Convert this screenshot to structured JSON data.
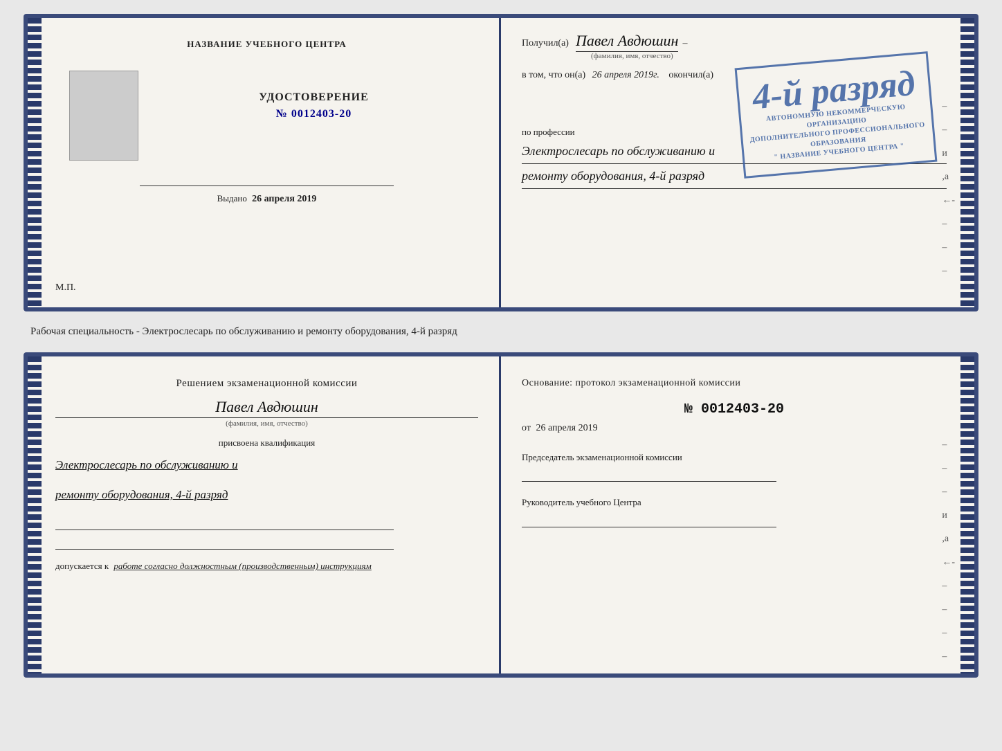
{
  "top_doc": {
    "left_page": {
      "title": "НАЗВАНИЕ УЧЕБНОГО ЦЕНТРА",
      "cert_label": "УДОСТОВЕРЕНИЕ",
      "cert_number": "№ 0012403-20",
      "issued_label": "Выдано",
      "issued_date": "26 апреля 2019",
      "mp_label": "М.П."
    },
    "right_page": {
      "recipient_prefix": "Получил(а)",
      "recipient_name": "Павел Авдюшин",
      "recipient_sub": "(фамилия, имя, отчество)",
      "vtom_prefix": "в том, что он(а)",
      "vtom_date": "26 апреля 2019г.",
      "vtom_ended": "окончил(а)",
      "stamp_line1": "4-й разряд",
      "stamp_org1": "АВТОНОМНУЮ НЕКОММЕРЧЕСКУЮ ОРГАНИЗАЦИЮ",
      "stamp_org2": "ДОПОЛНИТЕЛЬНОГО ПРОФЕССИОНАЛЬНОГО ОБРАЗОВАНИЯ",
      "stamp_org3": "\" НАЗВАНИЕ УЧЕБНОГО ЦЕНТРА \"",
      "profession_label": "по профессии",
      "profession_text": "Электрослесарь по обслуживанию и",
      "profession_text2": "ремонту оборудования, 4-й разряд",
      "dash": "–"
    }
  },
  "middle_text": "Рабочая специальность - Электрослесарь по обслуживанию и ремонту оборудования, 4-й разряд",
  "bottom_doc": {
    "left_page": {
      "decision_text": "Решением экзаменационной комиссии",
      "person_name": "Павел Авдюшин",
      "person_sub": "(фамилия, имя, отчество)",
      "assigned_label": "присвоена квалификация",
      "qualification_line1": "Электрослесарь по обслуживанию и",
      "qualification_line2": "ремонту оборудования, 4-й разряд",
      "allowed_label": "допускается к",
      "allowed_text": "работе согласно должностным (производственным) инструкциям"
    },
    "right_page": {
      "osnov_label": "Основание: протокол экзаменационной комиссии",
      "osnov_number": "№ 0012403-20",
      "osnov_date_prefix": "от",
      "osnov_date": "26 апреля 2019",
      "chairman_label": "Председатель экзаменационной комиссии",
      "director_label": "Руководитель учебного Центра"
    }
  }
}
